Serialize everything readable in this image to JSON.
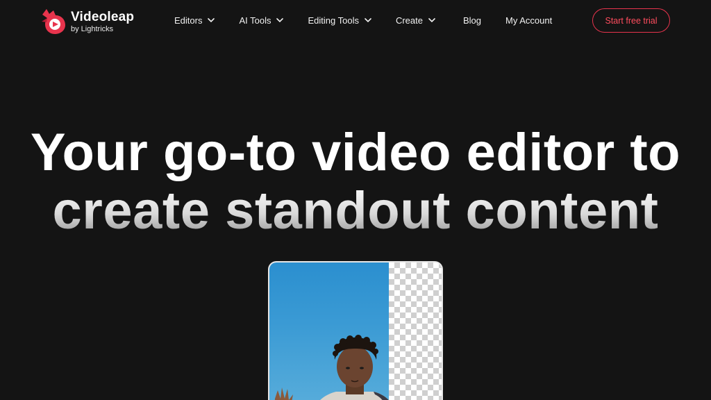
{
  "brand": {
    "name": "Videoleap",
    "tagline": "by Lightricks",
    "accent": "#e8344d"
  },
  "nav": {
    "items": [
      {
        "label": "Editors",
        "has_dropdown": true
      },
      {
        "label": "AI Tools",
        "has_dropdown": true
      },
      {
        "label": "Editing Tools",
        "has_dropdown": true
      },
      {
        "label": "Create",
        "has_dropdown": true
      },
      {
        "label": "Blog",
        "has_dropdown": false
      },
      {
        "label": "My Account",
        "has_dropdown": false
      }
    ],
    "cta_label": "Start free trial"
  },
  "hero": {
    "line1": "Your go-to video editor to",
    "line2": "create standout content"
  },
  "colors": {
    "background": "#141414",
    "text": "#ffffff",
    "cta_border": "#e8344d"
  },
  "icons": {
    "dropdown": "chevron-down-icon",
    "logo": "videoleap-logo-icon"
  }
}
